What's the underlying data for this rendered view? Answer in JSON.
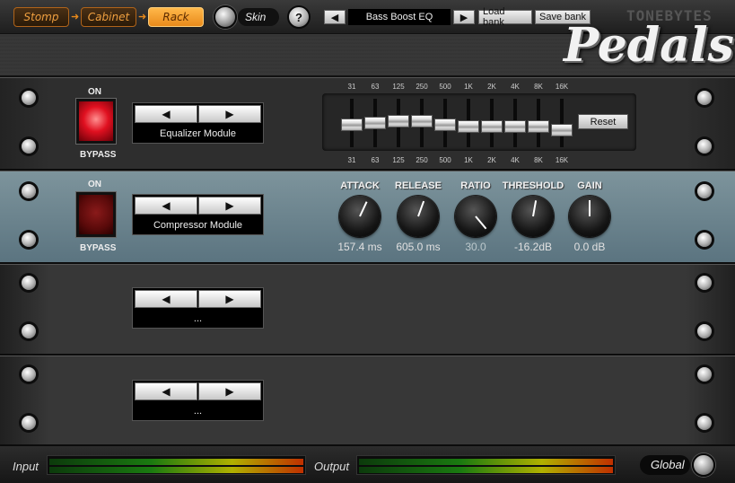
{
  "nav": {
    "stomp": "Stomp",
    "cabinet": "Cabinet",
    "rack": "Rack",
    "arrow": "➜",
    "skin_label": "Skin",
    "help_glyph": "?"
  },
  "preset": {
    "prev_glyph": "◀",
    "next_glyph": "▶",
    "name": "Bass Boost EQ",
    "load_bank": "Load bank",
    "save_bank": "Save bank"
  },
  "brand": {
    "small": "TONEBYTES",
    "big": "Pedals"
  },
  "slots": [
    {
      "on_label": "ON",
      "bypass_label": "BYPASS",
      "led_state": "on",
      "prev_glyph": "◀",
      "next_glyph": "▶",
      "module_name": "Equalizer Module"
    },
    {
      "on_label": "ON",
      "bypass_label": "BYPASS",
      "led_state": "off",
      "prev_glyph": "◀",
      "next_glyph": "▶",
      "module_name": "Compressor Module"
    },
    {
      "prev_glyph": "◀",
      "next_glyph": "▶",
      "module_name": "..."
    },
    {
      "prev_glyph": "◀",
      "next_glyph": "▶",
      "module_name": "..."
    }
  ],
  "eq": {
    "bands": [
      "31",
      "63",
      "125",
      "250",
      "500",
      "1K",
      "2K",
      "4K",
      "8K",
      "16K"
    ],
    "levels": [
      0.45,
      0.5,
      0.55,
      0.55,
      0.45,
      0.4,
      0.4,
      0.4,
      0.4,
      0.3
    ],
    "reset_label": "Reset"
  },
  "compressor": {
    "knobs": [
      {
        "label": "ATTACK",
        "value": "157.4 ms",
        "angle": 25
      },
      {
        "label": "RELEASE",
        "value": "605.0 ms",
        "angle": 20
      },
      {
        "label": "RATIO",
        "value": "30.0",
        "angle": 140
      },
      {
        "label": "THRESHOLD",
        "value": "-16.2dB",
        "angle": 10
      },
      {
        "label": "GAIN",
        "value": "0.0 dB",
        "angle": 0
      }
    ]
  },
  "bottom": {
    "input_label": "Input",
    "output_label": "Output",
    "global_label": "Global"
  },
  "colors": {
    "accent": "#e98a1b",
    "led_on": "#e01020",
    "compressor_panel": "#6e868f"
  }
}
